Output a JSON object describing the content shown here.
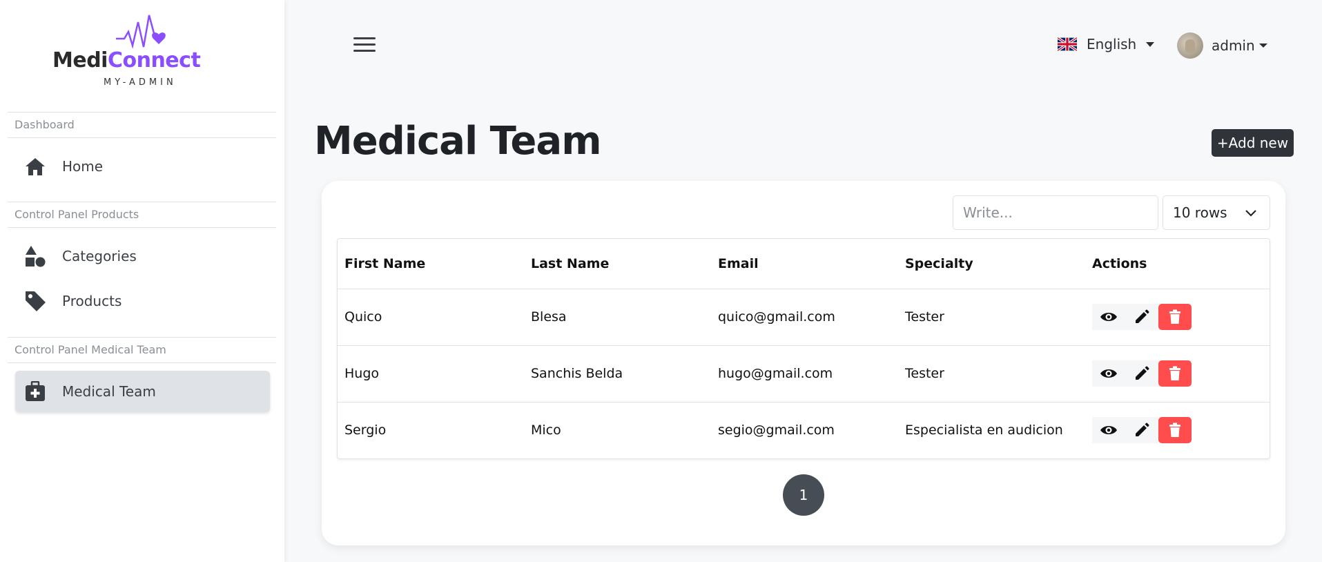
{
  "brand": {
    "name_part1": "Medi",
    "name_part2": "Connect",
    "subtitle": "MY-ADMIN",
    "accent_color": "#8a4dff",
    "icon": "heartbeat-heart-icon"
  },
  "sidebar": {
    "sections": [
      {
        "label": "Dashboard",
        "items": [
          {
            "label": "Home",
            "icon": "home-icon",
            "active": false
          }
        ]
      },
      {
        "label": "Control Panel Products",
        "items": [
          {
            "label": "Categories",
            "icon": "shapes-icon",
            "active": false
          },
          {
            "label": "Products",
            "icon": "tag-icon",
            "active": false
          }
        ]
      },
      {
        "label": "Control Panel Medical Team",
        "items": [
          {
            "label": "Medical Team",
            "icon": "medical-kit-icon",
            "active": true
          }
        ]
      }
    ]
  },
  "topbar": {
    "menu_icon": "hamburger-icon",
    "language": {
      "label": "English",
      "flag": "uk-flag-icon"
    },
    "user": {
      "name": "admin",
      "avatar": "avatar-image"
    }
  },
  "page": {
    "title": "Medical Team",
    "add_button": "+Add new"
  },
  "table": {
    "search_placeholder": "Write...",
    "rows_select": "10 rows",
    "columns": [
      "First Name",
      "Last Name",
      "Email",
      "Specialty",
      "Actions"
    ],
    "rows": [
      {
        "first": "Quico",
        "last": "Blesa",
        "email": "quico@gmail.com",
        "specialty": "Tester"
      },
      {
        "first": "Hugo",
        "last": "Sanchis Belda",
        "email": "hugo@gmail.com",
        "specialty": "Tester"
      },
      {
        "first": "Sergio",
        "last": "Mico",
        "email": "segio@gmail.com",
        "specialty": "Especialista en audicion"
      }
    ],
    "actions": [
      "view-icon",
      "edit-icon",
      "delete-icon"
    ],
    "delete_color": "#ff4d4d"
  },
  "pagination": {
    "current": "1"
  }
}
